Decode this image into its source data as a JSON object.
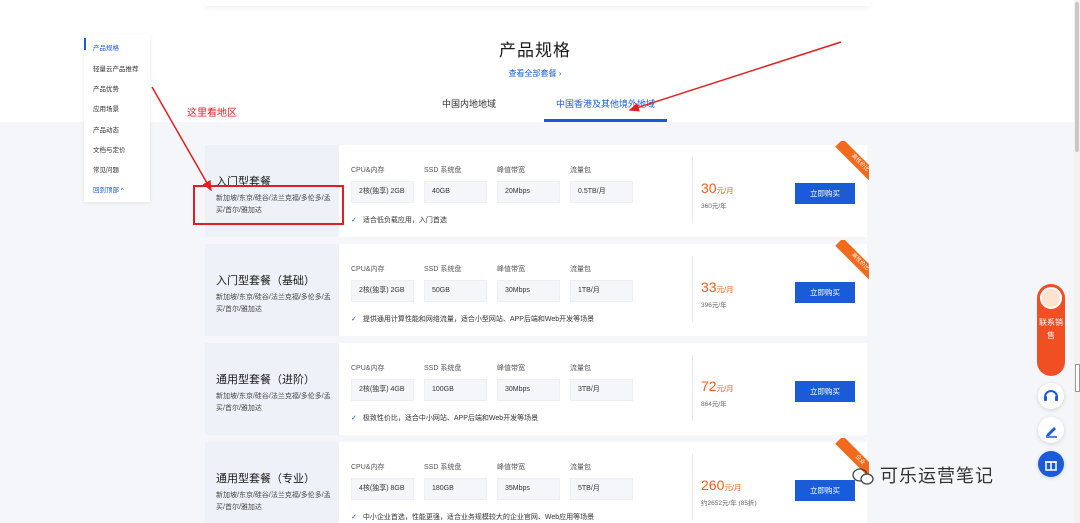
{
  "page": {
    "title": "产品规格",
    "view_all": "查看全部套餐",
    "tabs": [
      "中国内地地域",
      "中国香港及其他境外地域"
    ],
    "active_tab": 1
  },
  "sidenav": {
    "items": [
      "产品规格",
      "轻量云产品推荐",
      "产品优势",
      "应用场景",
      "产品动态",
      "文档与定价",
      "常见问题"
    ],
    "back_top": "回到顶部 ^",
    "active_index": 0
  },
  "annotation": {
    "text": "这里看地区"
  },
  "spec_labels": {
    "cpu": "CPU&内存",
    "ssd": "SSD 系统盘",
    "bandwidth": "峰值带宽",
    "traffic": "流量包"
  },
  "buy_label": "立即购买",
  "cards": [
    {
      "name": "入门型套餐",
      "regions": "新加坡/东京/硅谷/法兰克福/多伦多/孟买/首尔/雅加达",
      "cpu": "2核(独享) 2GB",
      "ssd": "40GB",
      "bandwidth": "20Mbps",
      "traffic": "0.5TB/月",
      "feature": "适合低负载应用，入门首选",
      "price": "30",
      "price_unit": "元/月",
      "year": "360元/年",
      "ribbon": "高性价比"
    },
    {
      "name": "入门型套餐（基础）",
      "regions": "新加坡/东京/硅谷/法兰克福/多伦多/孟买/首尔/雅加达",
      "cpu": "2核(独享) 2GB",
      "ssd": "50GB",
      "bandwidth": "30Mbps",
      "traffic": "1TB/月",
      "feature": "提供通用计算性能和网络流量，适合小型网站、APP后端和Web开发等场景",
      "price": "33",
      "price_unit": "元/月",
      "year": "396元/年",
      "ribbon": "高性价比"
    },
    {
      "name": "通用型套餐（进阶）",
      "regions": "新加坡/东京/硅谷/法兰克福/多伦多/孟买/首尔/雅加达",
      "cpu": "2核(独享) 4GB",
      "ssd": "100GB",
      "bandwidth": "30Mbps",
      "traffic": "3TB/月",
      "feature": "极致性价比，适合中小网站、APP后端和Web开发等场景",
      "price": "72",
      "price_unit": "元/月",
      "year": "864元/年",
      "ribbon": ""
    },
    {
      "name": "通用型套餐（专业）",
      "regions": "新加坡/东京/硅谷/法兰克福/多伦多/孟买/首尔/雅加达",
      "cpu": "4核(独享) 8GB",
      "ssd": "180GB",
      "bandwidth": "35Mbps",
      "traffic": "5TB/月",
      "feature": "中小企业首选，性能更强，适合业务规模较大的企业官网、Web应用等场景",
      "price": "260",
      "price_unit": "元/月",
      "year": "约2652元/年 (85折)",
      "ribbon": "企业"
    }
  ],
  "contact": {
    "text": "联系销售"
  },
  "watermark": "可乐运营笔记",
  "colors": {
    "accent": "#1a5bd8",
    "price": "#f25c1a",
    "annotation": "#e02020",
    "contact": "#f04e23"
  }
}
